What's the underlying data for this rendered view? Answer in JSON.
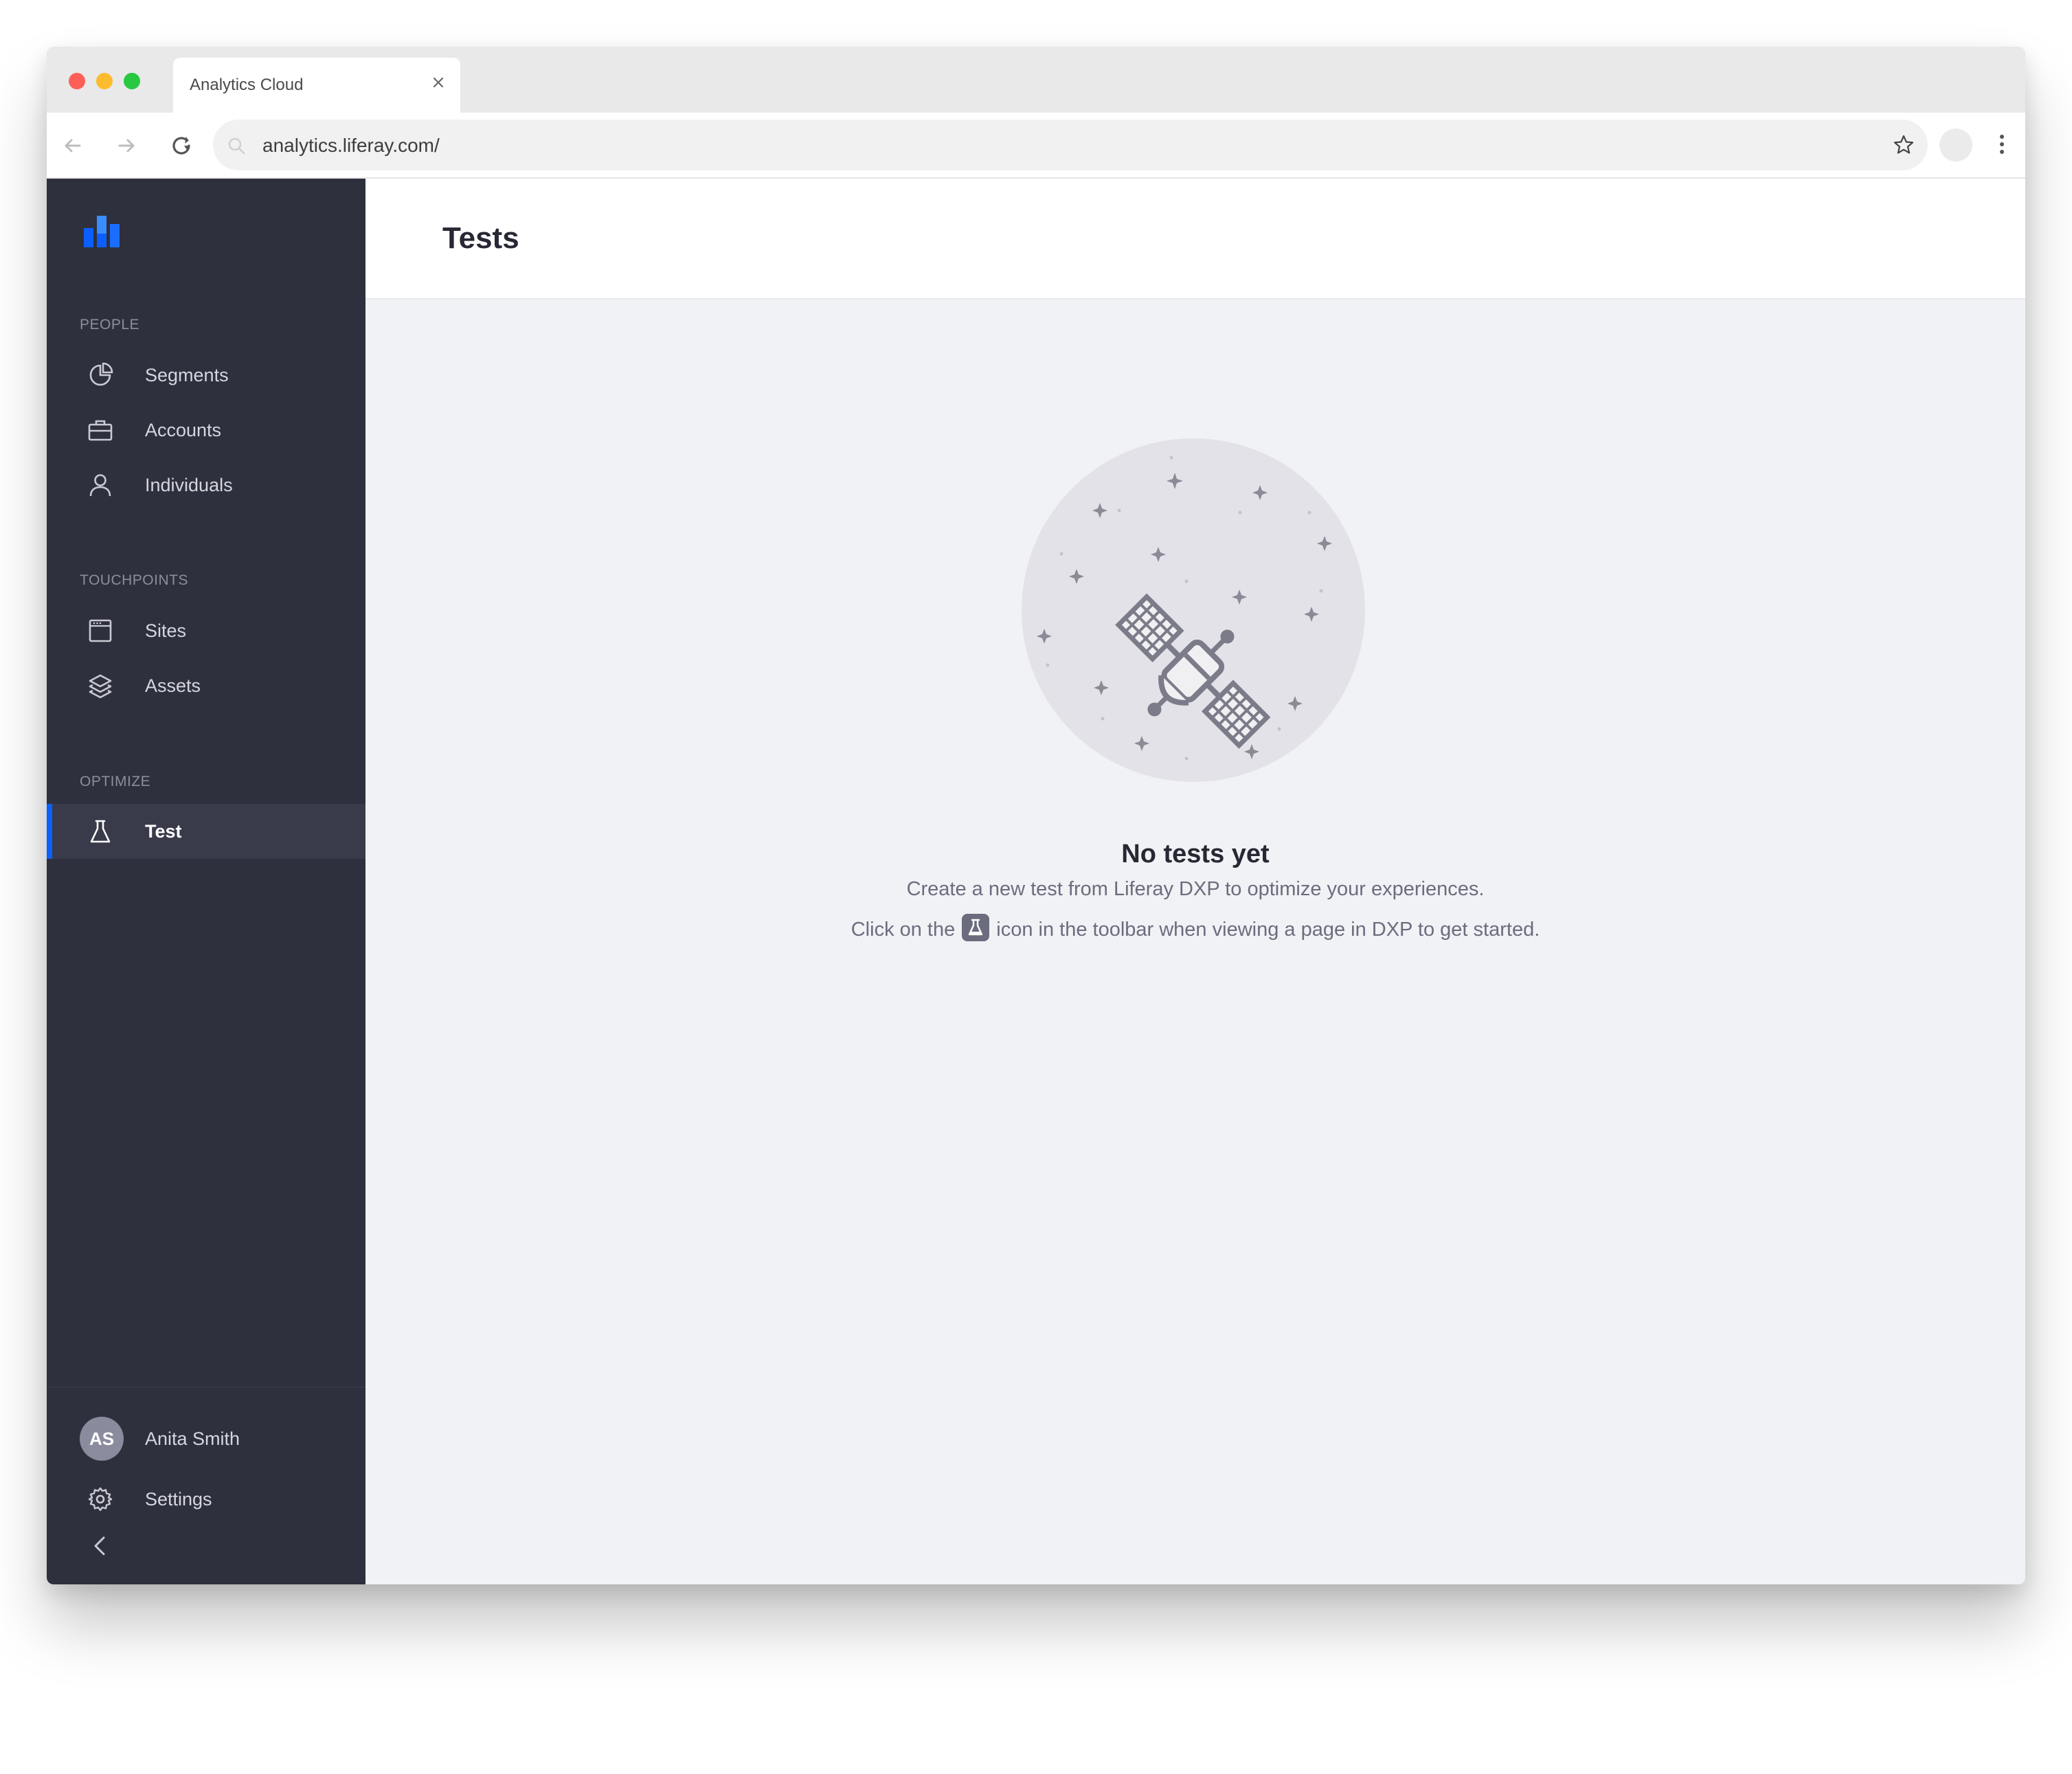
{
  "browser": {
    "tab_title": "Analytics Cloud",
    "url": "analytics.liferay.com/"
  },
  "sidebar": {
    "sections": [
      {
        "label": "PEOPLE",
        "items": [
          {
            "label": "Segments",
            "icon": "pie-chart-icon"
          },
          {
            "label": "Accounts",
            "icon": "briefcase-icon"
          },
          {
            "label": "Individuals",
            "icon": "user-icon"
          }
        ]
      },
      {
        "label": "TOUCHPOINTS",
        "items": [
          {
            "label": "Sites",
            "icon": "browser-window-icon"
          },
          {
            "label": "Assets",
            "icon": "layers-icon"
          }
        ]
      },
      {
        "label": "OPTIMIZE",
        "items": [
          {
            "label": "Test",
            "icon": "flask-icon",
            "active": true
          }
        ]
      }
    ],
    "user": {
      "initials": "AS",
      "name": "Anita Smith"
    },
    "settings_label": "Settings"
  },
  "page": {
    "title": "Tests",
    "empty_state": {
      "title": "No tests yet",
      "line1": "Create a new test from Liferay DXP to optimize your experiences.",
      "line2_before": "Click on the",
      "line2_after": "icon in the toolbar when viewing a page in DXP to get started."
    }
  },
  "colors": {
    "sidebar_bg": "#2e303d",
    "active_accent": "#0b5fff",
    "main_bg": "#f1f2f5"
  }
}
